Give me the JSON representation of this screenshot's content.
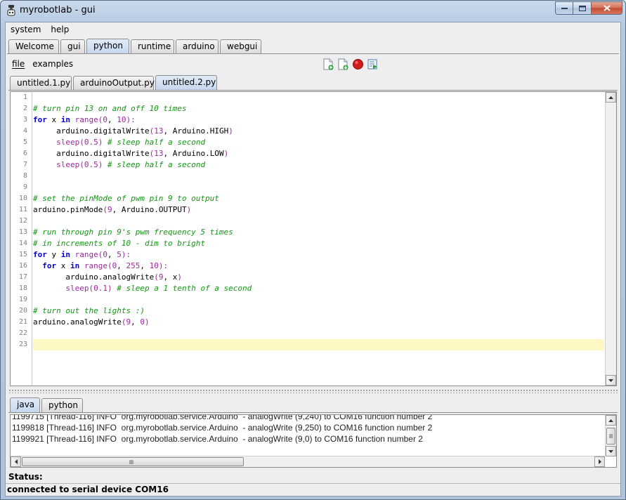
{
  "window": {
    "title": "myrobotlab - gui"
  },
  "menubar": {
    "items": [
      "system",
      "help"
    ]
  },
  "top_tabs": [
    "Welcome",
    "gui",
    "python",
    "runtime",
    "arduino",
    "webgui"
  ],
  "active_top_tab": "python",
  "python_menu": {
    "file": "file",
    "examples": "examples"
  },
  "toolbar_icons": [
    "new-script-icon",
    "open-script-icon",
    "stop-icon",
    "execute-icon"
  ],
  "file_tabs": [
    "untitled.1.py",
    "arduinoOutput.py",
    "untitled.2.py"
  ],
  "active_file_tab": "untitled.2.py",
  "editor": {
    "line_numbers": [
      "1",
      "2",
      "3",
      "4",
      "5",
      "6",
      "7",
      "8",
      "9",
      "10",
      "11",
      "12",
      "13",
      "14",
      "15",
      "16",
      "17",
      "18",
      "19",
      "20",
      "21",
      "22",
      "23"
    ],
    "current_line": "23",
    "lines": [
      "",
      "# turn pin 13 on and off 10 times",
      "for x in range(0, 10):",
      "     arduino.digitalWrite(13, Arduino.HIGH)",
      "     sleep(0.5) # sleep half a second",
      "     arduino.digitalWrite(13, Arduino.LOW)",
      "     sleep(0.5) # sleep half a second",
      "",
      "",
      "# set the pinMode of pwm pin 9 to output",
      "arduino.pinMode(9, Arduino.OUTPUT)",
      "",
      "# run through pin 9's pwm frequency 5 times",
      "# in increments of 10 - dim to bright",
      "for y in range(0, 5):",
      "  for x in range(0, 255, 10):",
      "       arduino.analogWrite(9, x)",
      "       sleep(0.1) # sleep a 1 tenth of a second",
      "",
      "# turn out the lights :)",
      "arduino.analogWrite(9, 0)",
      "",
      ""
    ]
  },
  "bottom_tabs": [
    "java",
    "python"
  ],
  "active_bottom_tab": "java",
  "log": {
    "lines": [
      "1199715 [Thread-116] INFO  org.myrobotlab.service.Arduino  - analogWrite (9,240) to COM16 function number 2",
      "1199818 [Thread-116] INFO  org.myrobotlab.service.Arduino  - analogWrite (9,250) to COM16 function number 2",
      "1199921 [Thread-116] INFO  org.myrobotlab.service.Arduino  - analogWrite (9,0) to COM16 function number 2"
    ]
  },
  "status": {
    "label": "Status:",
    "text": "connected to serial device COM16"
  },
  "colors": {
    "keyword": "#0000d0",
    "comment": "#159415",
    "number": "#9c2a9c",
    "current_line": "#fdf8c3"
  }
}
